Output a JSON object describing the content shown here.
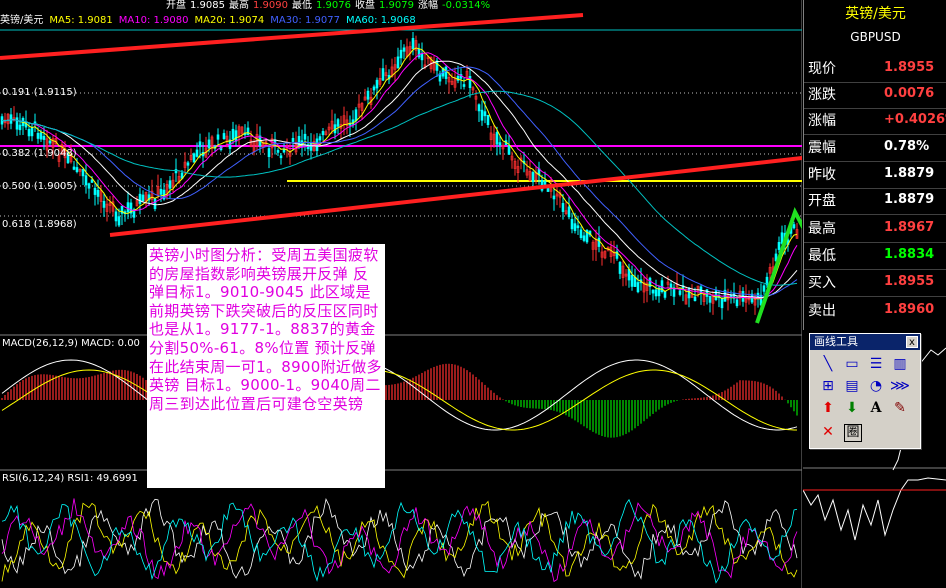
{
  "header": {
    "open_label": "开盘",
    "open_value": "1.9085",
    "high_label": "最高",
    "high_value": "1.9090",
    "low_label": "最低",
    "low_value": "1.9076",
    "close_label": "收盘",
    "close_value": "1.9079",
    "change_label": "涨幅",
    "change_value": "-0.0314%"
  },
  "ma_bar": {
    "symbol": "英镑/美元",
    "ma5": "MA5: 1.9081",
    "ma10": "MA10: 1.9080",
    "ma20": "MA20: 1.9074",
    "ma30": "MA30: 1.9077",
    "ma60": "MA60: 1.9068"
  },
  "fib_levels": [
    {
      "label": "0.191 (1.9115)"
    },
    {
      "label": "0.382 (1.9048)"
    },
    {
      "label": "0.500 (1.9005)"
    },
    {
      "label": "0.618 (1.8968)"
    }
  ],
  "macd_label": "MACD(26,12,9) MACD: 0.00",
  "rsi_label": "RSI(6,12,24) RSI1: 49.6991",
  "note": "英镑小时图分析：受周五美国疲软的房屋指数影响英镑展开反弹 反弹目标1。9010-9045 此区域是前期英镑下跌突破后的反压区同时也是从1。9177-1。8837的黄金分割50%-61。8%位置 预计反弹在此结束周一可1。8900附近做多英镑 目标1。9000-1。9040周二周三到达此位置后可建仓空英镑",
  "panel": {
    "title": "英镑/美元",
    "symbol": "GBPUSD",
    "rows": [
      {
        "label": "现价",
        "value": "1.8955",
        "color": "#ff4040"
      },
      {
        "label": "涨跌",
        "value": "0.0076",
        "color": "#ff4040"
      },
      {
        "label": "涨幅",
        "value": "+0.4026%",
        "color": "#ff4040"
      },
      {
        "label": "震幅",
        "value": "0.78%",
        "color": "#ffffff"
      },
      {
        "label": "昨收",
        "value": "1.8879",
        "color": "#ffffff"
      },
      {
        "label": "开盘",
        "value": "1.8879",
        "color": "#ffffff"
      },
      {
        "label": "最高",
        "value": "1.8967",
        "color": "#ff4040"
      },
      {
        "label": "最低",
        "value": "1.8834",
        "color": "#00ff00"
      },
      {
        "label": "买入",
        "value": "1.8955",
        "color": "#ff4040"
      },
      {
        "label": "卖出",
        "value": "1.8960",
        "color": "#ff4040"
      }
    ]
  },
  "toolbox": {
    "title": "画线工具",
    "close": "x",
    "text_tool": "A",
    "circle_tool": "圈"
  },
  "colors": {
    "up": "#ff3030",
    "down": "#00ffff",
    "trend": "#ff2020",
    "projection": "#20e020",
    "fib": "#ffffff",
    "resist": "#ff00ff",
    "support": "#ffff00"
  }
}
